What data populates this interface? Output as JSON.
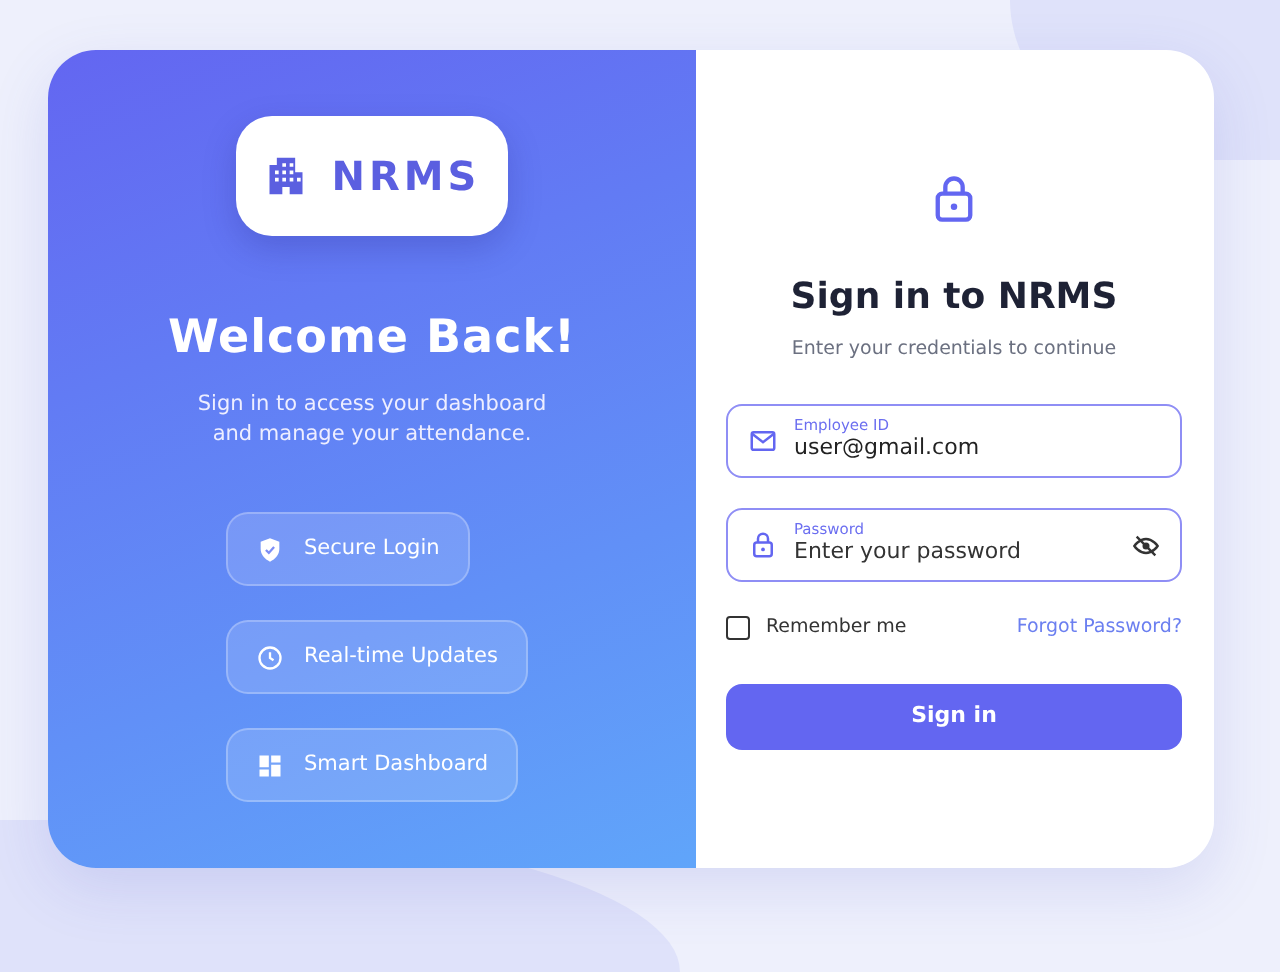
{
  "brand": {
    "name": "NRMS"
  },
  "welcome": {
    "title": "Welcome Back!",
    "subtitle": "Sign in to access your dashboard and manage your attendance."
  },
  "features": [
    {
      "kind": "shield",
      "label": "Secure Login"
    },
    {
      "kind": "clock",
      "label": "Real-time Updates"
    },
    {
      "kind": "grid",
      "label": "Smart Dashboard"
    }
  ],
  "form": {
    "title": "Sign in to NRMS",
    "subtitle": "Enter your credentials to continue",
    "fields": [
      {
        "kind": "email",
        "label": "Employee ID",
        "value": "user@gmail.com"
      },
      {
        "kind": "password",
        "label": "Password",
        "placeholder": "Enter your password"
      }
    ],
    "remember": {
      "label": "Remember me",
      "checked": false
    },
    "forgot_link": "Forgot Password?",
    "submit": "Sign in"
  }
}
